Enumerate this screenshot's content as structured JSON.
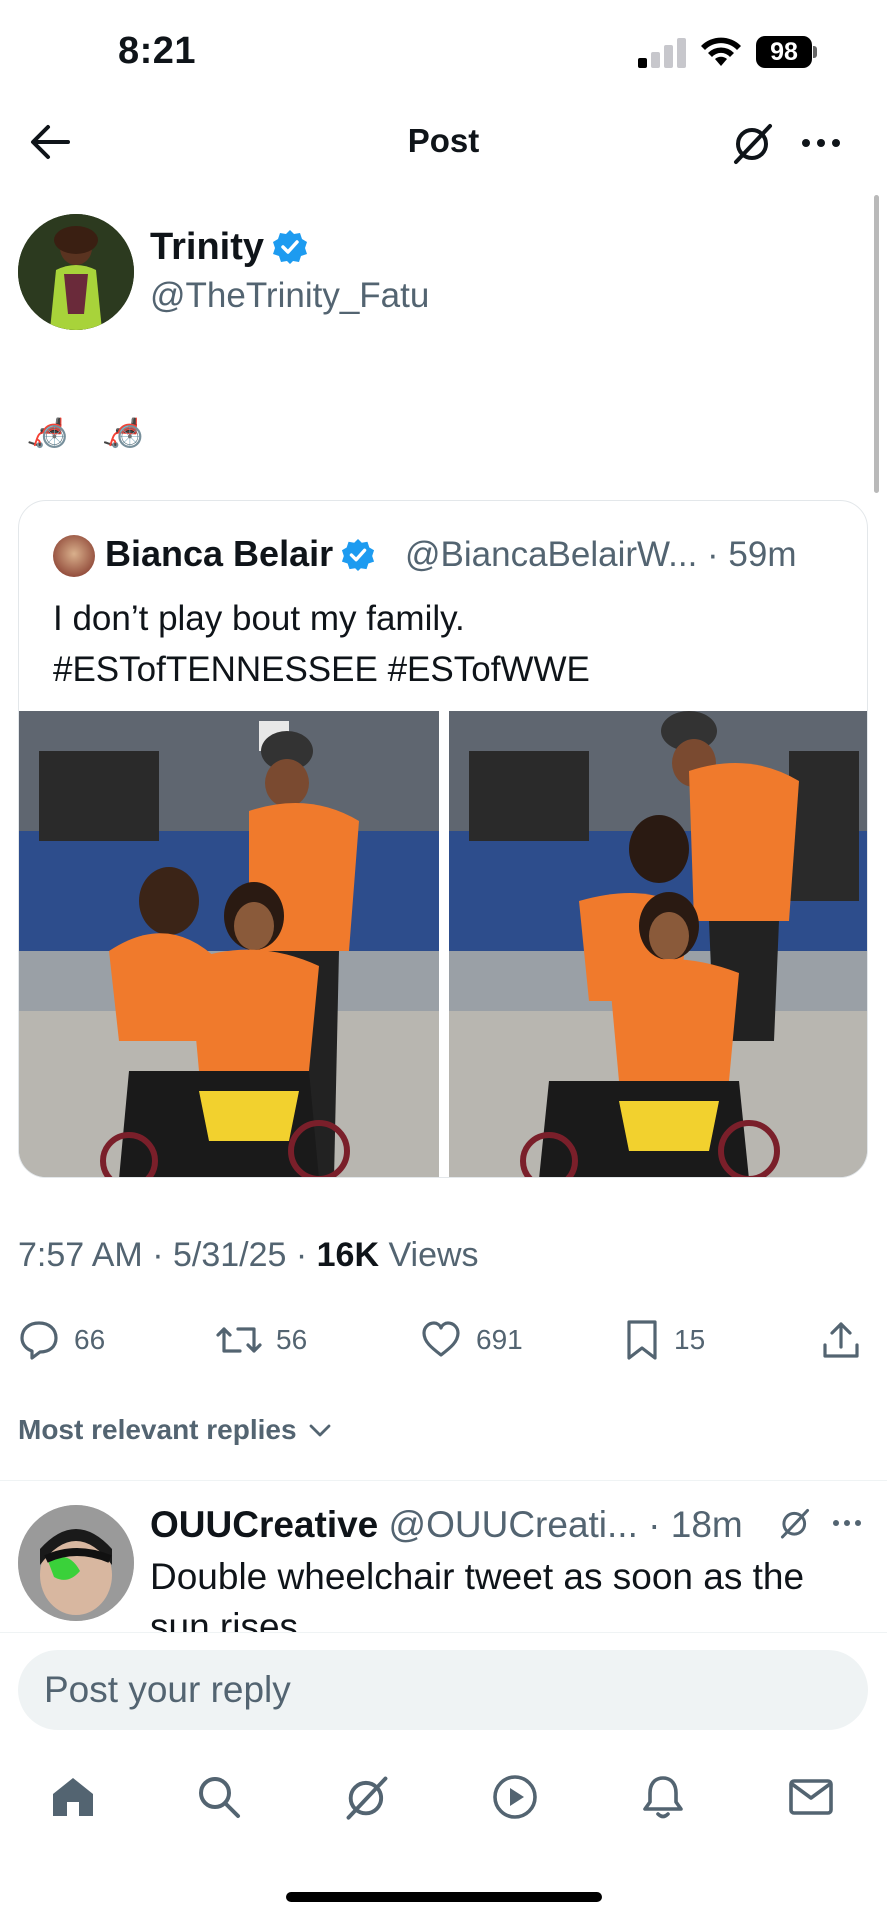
{
  "status_bar": {
    "time": "8:21",
    "battery": "98"
  },
  "header": {
    "title": "Post"
  },
  "post": {
    "author_name": "Trinity",
    "author_handle": "@TheTrinity_Fatu",
    "text": "🦽 🦽",
    "timestamp": "7:57 AM · 5/31/25 · ",
    "views_count": "16K",
    "views_label": " Views"
  },
  "quote": {
    "name": "Bianca Belair",
    "handle": "@BiancaBelairW... · 59m",
    "text_line1": "I don’t play bout my family.",
    "text_line2": "#ESTofTENNESSEE #ESTofWWE"
  },
  "actions": {
    "replies": "66",
    "reposts": "56",
    "likes": "691",
    "bookmarks": "15"
  },
  "replies_filter": "Most relevant replies",
  "reply": {
    "name": "OUUCreative",
    "handle": " @OUUCreati... · 18m",
    "text": "Double wheelchair tweet as soon as the sun rises"
  },
  "compose": {
    "placeholder": "Post your reply"
  },
  "icons": {
    "verified_color": "#1d9bf0",
    "accent": "#0f1419",
    "muted": "#536471"
  }
}
